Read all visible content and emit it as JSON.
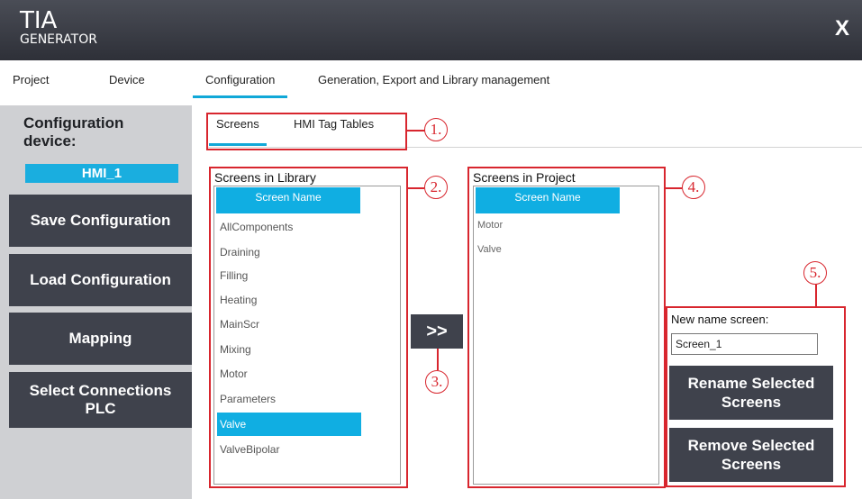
{
  "app": {
    "logo_main": "TIA",
    "logo_sub": "GENERATOR",
    "close_label": "X"
  },
  "main_tabs": [
    {
      "label": "Project"
    },
    {
      "label": "Device"
    },
    {
      "label": "Configuration",
      "active": true
    },
    {
      "label": "Generation, Export and Library management"
    }
  ],
  "sidebar": {
    "title": "Configuration device:",
    "device": "HMI_1",
    "buttons": [
      {
        "label": "Save Configuration"
      },
      {
        "label": "Load Configuration"
      },
      {
        "label": "Mapping"
      },
      {
        "label": "Select Connections PLC"
      }
    ]
  },
  "sub_tabs": [
    {
      "label": "Screens",
      "active": true
    },
    {
      "label": "HMI Tag Tables"
    }
  ],
  "library": {
    "title": "Screens in Library",
    "column_header": "Screen Name",
    "items": [
      "AllComponents",
      "Draining",
      "Filling",
      "Heating",
      "MainScr",
      "Mixing",
      "Motor",
      "Parameters",
      "Valve",
      "ValveBipolar"
    ],
    "selected": "Valve"
  },
  "move_button": ">>",
  "project": {
    "title": "Screens in Project",
    "column_header": "Screen Name",
    "items": [
      "Motor",
      "Valve"
    ]
  },
  "rename": {
    "label": "New name screen:",
    "value": "Screen_1",
    "rename_button": "Rename Selected Screens",
    "remove_button": "Remove Selected Screens"
  },
  "callouts": [
    "1.",
    "2.",
    "3.",
    "4.",
    "5."
  ],
  "colors": {
    "accent": "#10aee2",
    "button": "#3f424c",
    "callout": "#d8262e"
  }
}
